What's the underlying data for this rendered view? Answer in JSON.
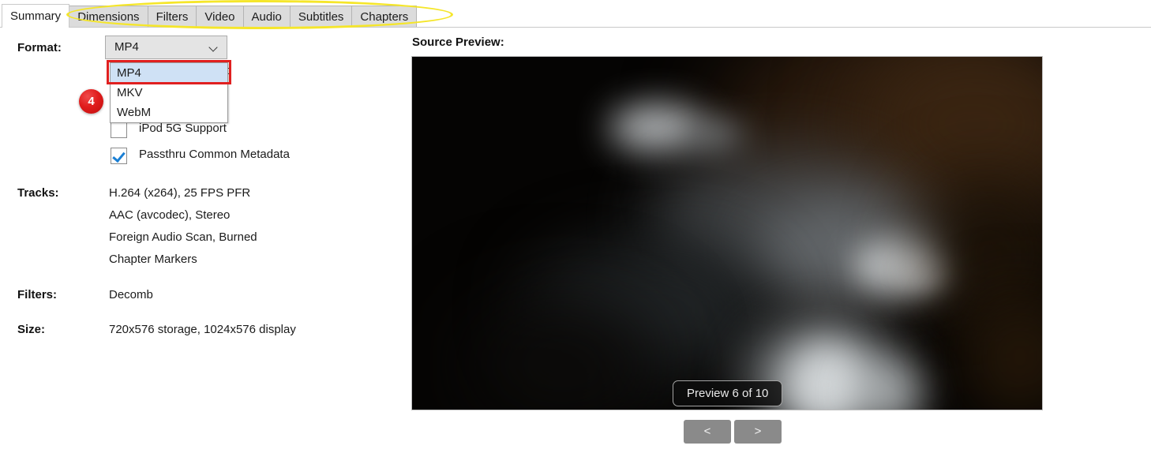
{
  "tabs": [
    {
      "label": "Summary",
      "active": true
    },
    {
      "label": "Dimensions",
      "active": false
    },
    {
      "label": "Filters",
      "active": false
    },
    {
      "label": "Video",
      "active": false
    },
    {
      "label": "Audio",
      "active": false
    },
    {
      "label": "Subtitles",
      "active": false
    },
    {
      "label": "Chapters",
      "active": false
    }
  ],
  "annotations": {
    "tab_highlight_color": "#f5e62a",
    "focus_ring_color": "#e02020",
    "step_badge_number": "4",
    "step_badge_color": "#e01d1d"
  },
  "settings": {
    "format": {
      "label": "Format:",
      "selected": "MP4",
      "options": [
        "MP4",
        "MKV",
        "WebM"
      ],
      "expanded": true
    },
    "checkboxes": [
      {
        "label": "iPod 5G Support",
        "checked": false
      },
      {
        "label": "Passthru Common Metadata",
        "checked": true
      }
    ],
    "obscured_option_fragment": "d",
    "tracks": {
      "label": "Tracks:",
      "values": [
        "H.264 (x264), 25 FPS PFR",
        "AAC (avcodec), Stereo",
        "Foreign Audio Scan, Burned",
        "Chapter Markers"
      ]
    },
    "filters": {
      "label": "Filters:",
      "value": "Decomb"
    },
    "size": {
      "label": "Size:",
      "value": "720x576 storage, 1024x576 display"
    }
  },
  "preview": {
    "title": "Source Preview:",
    "counter": "Preview 6 of 10",
    "prev_button": "<",
    "next_button": ">"
  }
}
